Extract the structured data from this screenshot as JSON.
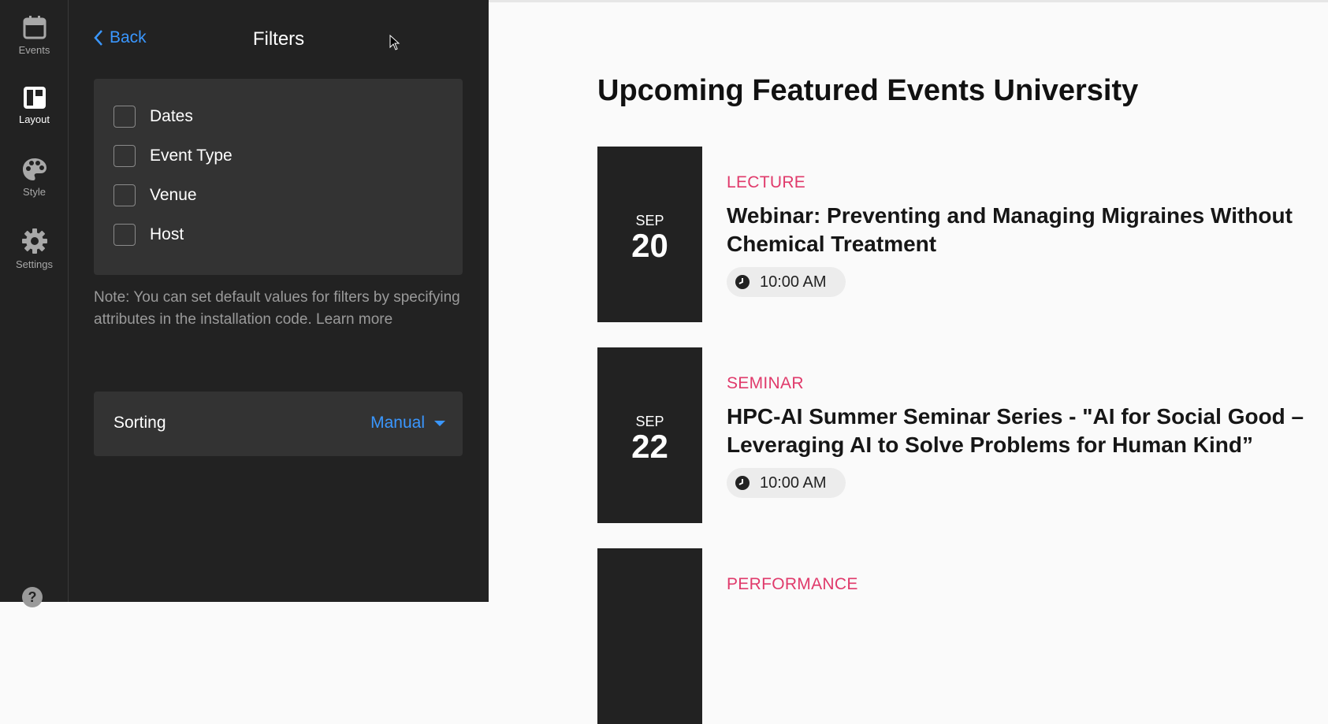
{
  "rail": {
    "items": [
      {
        "label": "Events",
        "icon": "calendar-icon"
      },
      {
        "label": "Layout",
        "icon": "layout-icon",
        "active": true
      },
      {
        "label": "Style",
        "icon": "palette-icon"
      },
      {
        "label": "Settings",
        "icon": "gear-icon"
      }
    ],
    "help_icon": "question-icon"
  },
  "panel": {
    "back_label": "Back",
    "title": "Filters",
    "filters": [
      "Dates",
      "Event Type",
      "Venue",
      "Host"
    ],
    "note": "Note: You can set default values for filters by specifying attributes in the installation code.",
    "learn_more": "Learn more",
    "sorting_label": "Sorting",
    "sorting_value": "Manual"
  },
  "main": {
    "title": "Upcoming Featured Events University",
    "events": [
      {
        "month": "SEP",
        "day": "20",
        "category": "LECTURE",
        "title": "Webinar: Preventing and Managing Migraines Without Chemical Treatment",
        "time": "10:00 AM"
      },
      {
        "month": "SEP",
        "day": "22",
        "category": "SEMINAR",
        "title": "HPC-AI Summer Seminar Series - \"AI for Social Good – Leveraging AI to Solve Problems for Human Kind”",
        "time": "10:00 AM"
      },
      {
        "month": "",
        "day": "",
        "category": "PERFORMANCE",
        "title": "",
        "time": ""
      }
    ]
  },
  "colors": {
    "accent": "#3a97ff",
    "category": "#e03a6b",
    "sidebar_bg": "#222222",
    "card_bg": "#333333"
  }
}
